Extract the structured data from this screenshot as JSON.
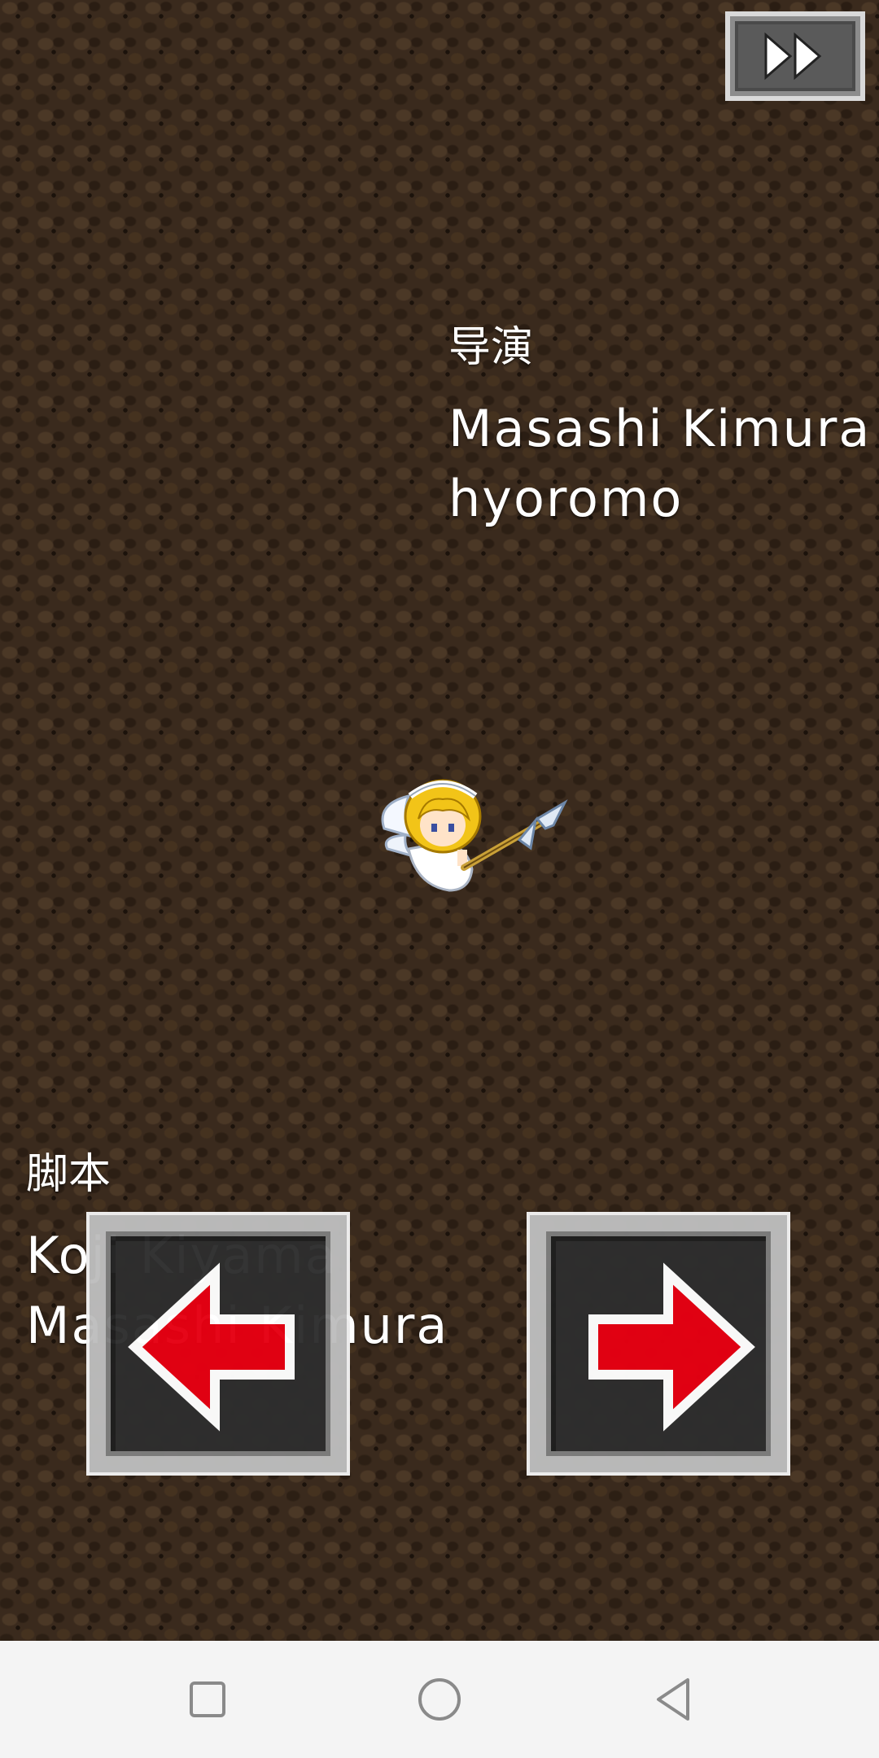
{
  "credits": {
    "director_heading": "导演",
    "director_names": [
      "Masashi Kimura",
      "hyoromo"
    ],
    "script_heading": "脚本",
    "script_names": [
      "Koji Kiyama",
      "Masashi Kimura"
    ]
  },
  "controls": {
    "fast_forward_icon": "fast-forward-icon",
    "left_icon": "red-left-arrow-icon",
    "right_icon": "red-right-arrow-icon"
  },
  "navbar": {
    "recents_icon": "square-icon",
    "home_icon": "circle-icon",
    "back_icon": "triangle-back-icon"
  },
  "colors": {
    "arrow_red": "#e60012",
    "background": "#3a2a1d",
    "text": "#ffffff"
  }
}
